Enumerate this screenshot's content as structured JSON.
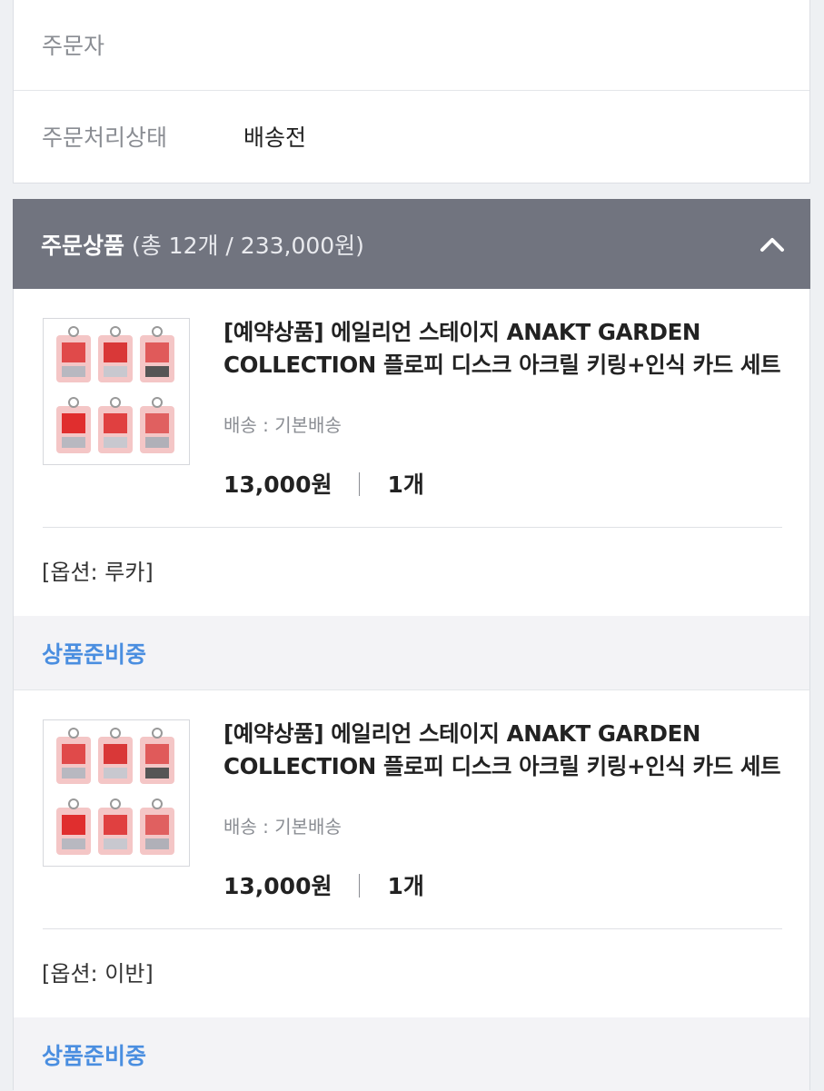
{
  "order_info": {
    "orderer_label": "주문자",
    "orderer_value": "",
    "status_label": "주문처리상태",
    "status_value": "배송전"
  },
  "ordered_items": {
    "title": "주문상품",
    "summary": "(총 12개 / 233,000원)",
    "collapse_icon": "chevron-up-icon"
  },
  "items": [
    {
      "name": "[예약상품] 에일리언 스테이지 ANAKT GARDEN COLLECTION 플로피 디스크 아크릴 키링+인식 카드 세트",
      "shipping": "배송 : 기본배송",
      "price": "13,000원",
      "qty": "1개",
      "option": "[옵션: 루카]",
      "status": "상품준비중"
    },
    {
      "name": "[예약상품] 에일리언 스테이지 ANAKT GARDEN COLLECTION 플로피 디스크 아크릴 키링+인식 카드 세트",
      "shipping": "배송 : 기본배송",
      "price": "13,000원",
      "qty": "1개",
      "option": "[옵션: 이반]",
      "status": "상품준비중"
    }
  ],
  "colors": {
    "header_bg": "#71747f",
    "status_text": "#4a8ee0",
    "status_bg": "#f3f3f6"
  }
}
